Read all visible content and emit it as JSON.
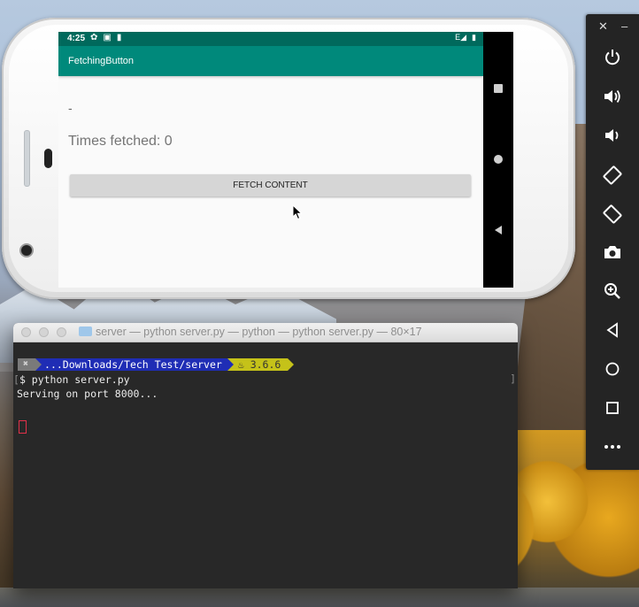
{
  "phone": {
    "status_time": "4:25",
    "app_title": "FetchingButton",
    "content_text": "-",
    "times_fetched": "Times fetched: 0",
    "fetch_button_label": "FETCH CONTENT",
    "nav_icons": [
      "recents-icon",
      "home-icon",
      "back-icon"
    ]
  },
  "emulator_toolbar": {
    "close": "✕",
    "minimize": "–",
    "buttons": [
      "power-icon",
      "volume-up-icon",
      "volume-down-icon",
      "rotate-left-icon",
      "rotate-right-icon",
      "camera-icon",
      "zoom-icon",
      "back-icon",
      "home-icon",
      "overview-icon",
      "more-icon"
    ]
  },
  "terminal": {
    "title": "server — python server.py — python — python server.py — 80×17",
    "prompt_path": "...Downloads/Tech Test/server",
    "python_version": "3.6.6",
    "command_line": "$ python server.py",
    "output_line": "Serving on port 8000..."
  },
  "colors": {
    "status_bar": "#00695c",
    "app_bar": "#00897b",
    "prompt_path_bg": "#1f2db5",
    "prompt_version_bg": "#c5c219",
    "terminal_bg": "#282828"
  }
}
